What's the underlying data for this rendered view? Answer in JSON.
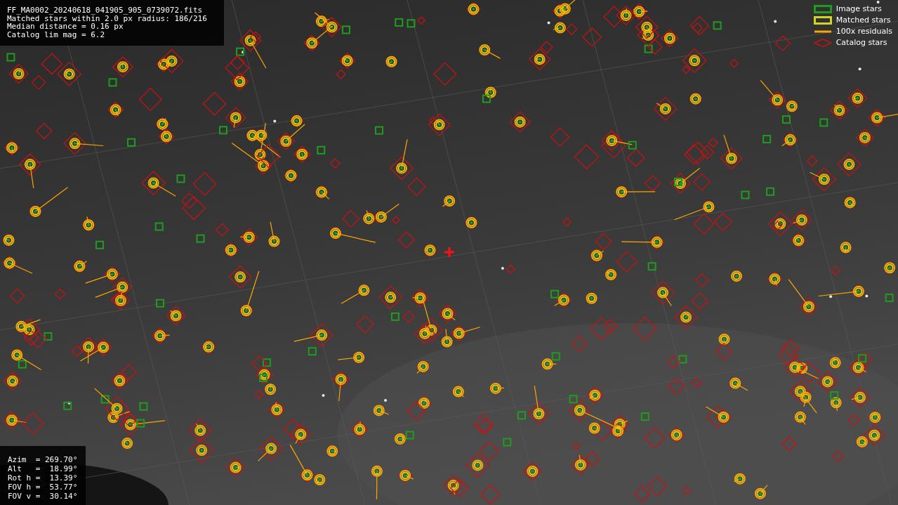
{
  "info_box": {
    "lines": [
      "FF_MA0002_20240618_041905_905_0739072.fits",
      "Matched stars within 2.0 px radius: 186/216",
      "Median distance = 0.16 px",
      "Catalog lim mag = 6.2"
    ]
  },
  "pointing_box": {
    "lines": [
      "Azim  = 269.70°",
      "Alt   =  18.99°",
      "Rot h =  13.39°",
      "FOV h =  53.77°",
      "FOV v =  30.14°"
    ]
  },
  "legend": [
    {
      "kind": "box",
      "color": "#1e9c1e",
      "label": "Image stars"
    },
    {
      "kind": "box",
      "color": "#d4d41e",
      "label": "Matched stars"
    },
    {
      "kind": "line",
      "color": "#ffa500",
      "label": "100x residuals"
    },
    {
      "kind": "diamond",
      "color": "#cc1111",
      "label": "Catalog stars"
    }
  ]
}
